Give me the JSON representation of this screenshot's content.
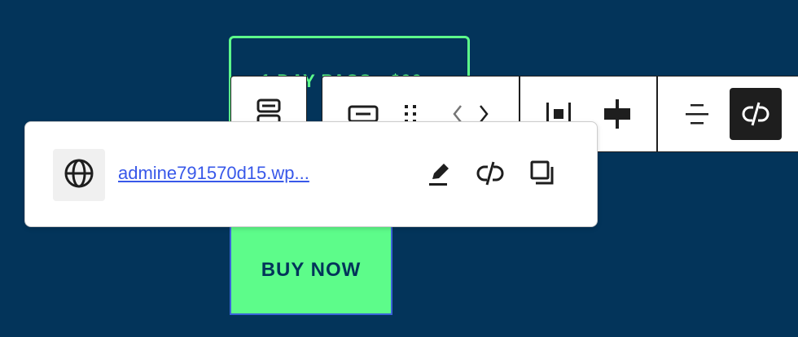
{
  "background": {
    "pass_title": "1 DAY PASS - $99",
    "cta_label": "BUY NOW"
  },
  "toolbar": {
    "parent_icon": "stack-icon",
    "buttons": [
      {
        "icon": "button-block-icon"
      },
      {
        "icon": "drag-handle-icon"
      },
      {
        "icon": "move-left-icon"
      },
      {
        "icon": "move-right-icon"
      },
      {
        "icon": "justify-icon"
      },
      {
        "icon": "align-center-icon"
      },
      {
        "icon": "text-align-icon"
      },
      {
        "icon": "unlink-icon",
        "active": true
      }
    ]
  },
  "link_popover": {
    "url_text": "admine791570d15.wp...",
    "icons": [
      "globe-icon",
      "edit-pencil-icon",
      "unlink-icon",
      "copy-icon"
    ]
  },
  "colors": {
    "page_bg": "#03345a",
    "accent_green": "#5dfc8a",
    "link_blue": "#3858e9",
    "toolbar_dark": "#1e1e1e"
  }
}
